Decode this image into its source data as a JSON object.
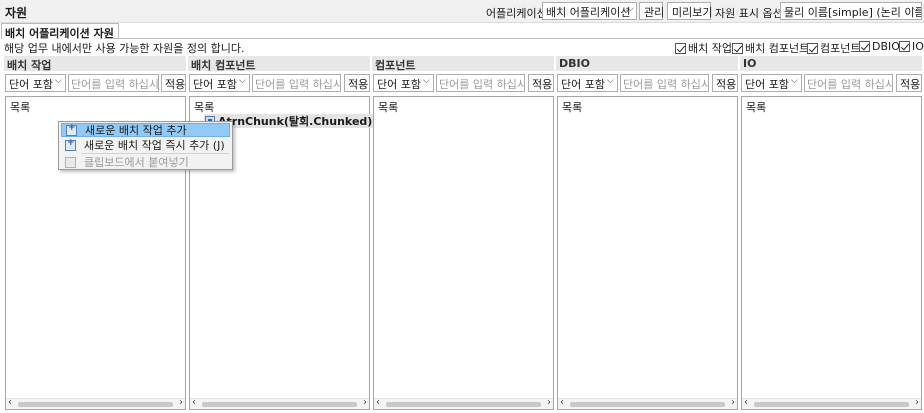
{
  "window": {
    "title": "자원"
  },
  "toolbar": {
    "app_label": "어플리케이션",
    "app_select": "배치 어플리케이션",
    "manage_label": "관리",
    "preview_label": "미리보기",
    "display_label": "자원 표시 옵션",
    "display_select": "물리 이름[simple] (논리 이름)"
  },
  "tab": {
    "label": "배치 어플리케이션 자원"
  },
  "description": "해당 업무 내에서만 사용 가능한 자원을 정의 합니다.",
  "filters": [
    "배치 작업",
    "배치 컴포넌트",
    "컴포넌트",
    "DBIO",
    "IO"
  ],
  "panels": [
    {
      "title": "배치 작업",
      "mode": "단어 포함",
      "placeholder": "단어를 입력 하십시오",
      "apply": "적용",
      "root": "목록"
    },
    {
      "title": "배치 컴포넌트",
      "mode": "단어 포함",
      "placeholder": "단어를 입력 하십시오",
      "apply": "적용",
      "root": "목록",
      "items": [
        "AtrnChunk(탈회.Chunked)"
      ]
    },
    {
      "title": "컴포넌트",
      "mode": "단어 포함",
      "placeholder": "단어를 입력 하십시오",
      "apply": "적용",
      "root": "목록"
    },
    {
      "title": "DBIO",
      "mode": "단어 포함",
      "placeholder": "단어를 입력 하십시오",
      "apply": "적용",
      "root": "목록"
    },
    {
      "title": "IO",
      "mode": "단어 포함",
      "placeholder": "단어를 입력 하십시오",
      "apply": "적용",
      "root": "목록"
    }
  ],
  "context_menu": {
    "items": [
      {
        "label": "새로운 배치 작업 추가",
        "icon": "add-job-icon",
        "state": "highlighted"
      },
      {
        "label": "새로운 배치 작업 즉시 추가 (J)",
        "icon": "add-job-icon",
        "state": "normal"
      },
      {
        "label": "클립보드에서 붙여넣기",
        "icon": "paste-icon",
        "state": "disabled"
      }
    ]
  },
  "icons": {
    "dropdown": "chevron-down-icon",
    "scroll_left": "scroll-left-icon",
    "scroll_right": "scroll-right-icon"
  }
}
